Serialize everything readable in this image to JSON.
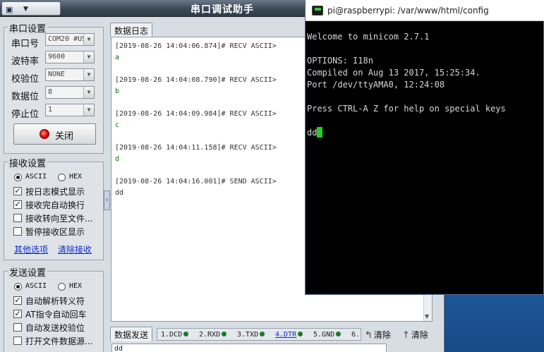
{
  "serial": {
    "title": "串口调试助手",
    "sysmenu_icon": "▣",
    "sysmenu_arrow": "▼",
    "port_group": "串口设置",
    "fields": [
      {
        "label": "串口号",
        "value": "COM20 #US"
      },
      {
        "label": "波特率",
        "value": "9600"
      },
      {
        "label": "校验位",
        "value": "NONE"
      },
      {
        "label": "数据位",
        "value": "8"
      },
      {
        "label": "停止位",
        "value": "1"
      }
    ],
    "close_button": "关闭",
    "receive_group": "接收设置",
    "receive_modes": [
      "ASCII",
      "HEX"
    ],
    "receive_options": [
      "按日志模式显示",
      "接收完自动换行",
      "接收转向至文件...",
      "暂停接收区显示"
    ],
    "receive_checked": [
      true,
      true,
      false,
      false
    ],
    "links": [
      "其他选项",
      "清除接收"
    ],
    "send_group": "发送设置",
    "send_modes": [
      "ASCII",
      "HEX"
    ],
    "send_options": [
      "自动解析转义符",
      "AT指令自动回车",
      "自动发送校验位",
      "打开文件数据源..."
    ],
    "send_checked": [
      true,
      true,
      false,
      false
    ],
    "log_tab": "数据日志",
    "log": [
      {
        "header": "[2019-08-26 14:04:06.874]# RECV ASCII>",
        "data": "a"
      },
      {
        "header": "[2019-08-26 14:04:08.790]# RECV ASCII>",
        "data": "b"
      },
      {
        "header": "[2019-08-26 14:04:09.984]# RECV ASCII>",
        "data": "c"
      },
      {
        "header": "[2019-08-26 14:04:11.158]# RECV ASCII>",
        "data": "d"
      },
      {
        "header": "[2019-08-26 14:04:16.001]# SEND ASCII>",
        "data": "dd"
      }
    ],
    "send_tab": "数据发送",
    "pins": [
      "1.DCD",
      "2.RXD",
      "3.TXD",
      "4.DTR",
      "5.GND",
      "6."
    ],
    "clear_labels": [
      "清除",
      "清除"
    ],
    "send_value": "dd"
  },
  "terminal": {
    "title": "pi@raspberrypi: /var/www/html/config",
    "lines": [
      "Welcome to minicom 2.7.1",
      "",
      "OPTIONS: I18n",
      "Compiled on Aug 13 2017, 15:25:34.",
      "Port /dev/ttyAMA0, 12:24:08",
      "",
      "Press CTRL-A Z for help on special keys",
      "",
      "dd"
    ]
  },
  "colors": {
    "cursor": "#20d020",
    "led": "#e00000",
    "pin_dot": "#1a7a2c",
    "link": "#1030c0"
  }
}
